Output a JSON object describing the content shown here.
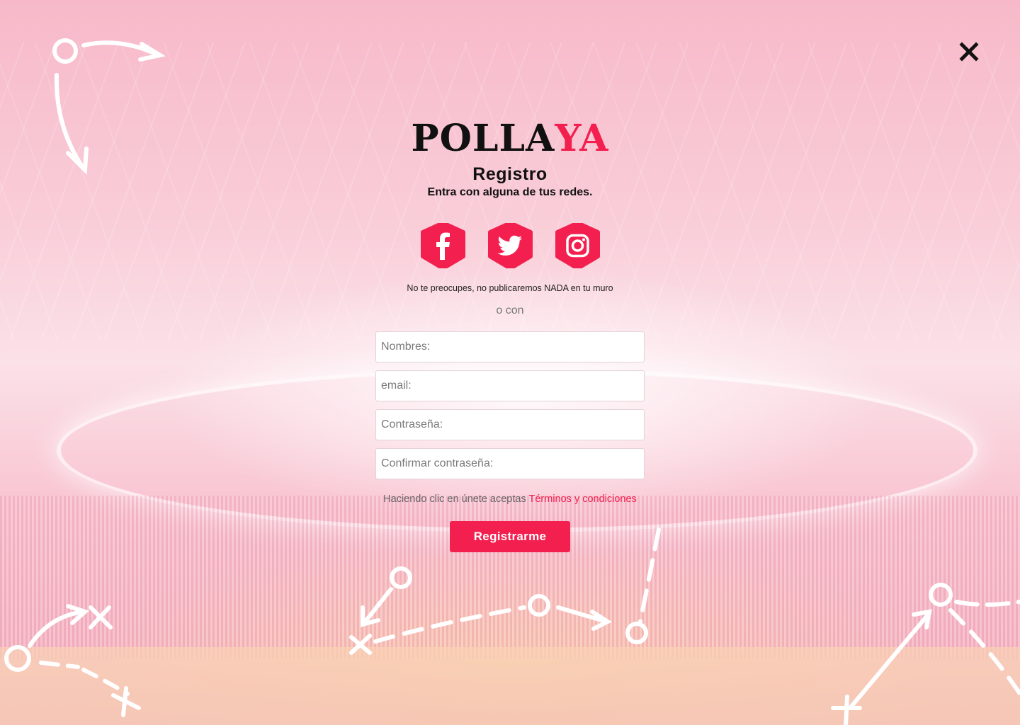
{
  "brand": {
    "logo_dark": "POLLA",
    "logo_accent": "YA",
    "accent_color": "#f3204f"
  },
  "header": {
    "title": "Registro",
    "subtitle": "Entra con alguna de tus redes."
  },
  "social": [
    {
      "name": "facebook",
      "icon": "facebook-icon"
    },
    {
      "name": "twitter",
      "icon": "twitter-icon"
    },
    {
      "name": "instagram",
      "icon": "instagram-icon"
    }
  ],
  "social_note": "No te preocupes, no publicaremos NADA en tu muro",
  "divider_text": "o con",
  "form": {
    "name_placeholder": "Nombres:",
    "email_placeholder": "email:",
    "password_placeholder": "Contraseña:",
    "confirm_placeholder": "Confirmar contraseña:"
  },
  "terms": {
    "prefix": "Haciendo clic en únete aceptas",
    "link": "Términos y condiciones"
  },
  "submit_label": "Registrarme",
  "close_icon": "close-icon"
}
